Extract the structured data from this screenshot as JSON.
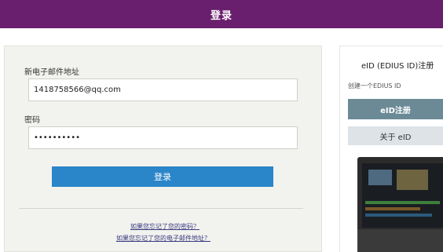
{
  "header": {
    "title": "登录"
  },
  "login_form": {
    "email_label": "新电子邮件地址",
    "email_value": "1418758566@qq.com",
    "password_label": "密码",
    "password_value": "••••••••••",
    "submit_label": "登录",
    "forgot_password_link": "如果您忘记了您的密码？",
    "forgot_email_link": "如果您忘记了您的电子邮件地址？"
  },
  "side": {
    "title": "eID (EDIUS ID)注册",
    "subtitle": "创建一个EDIUS ID",
    "register_button": "eID注册",
    "about_button": "关于 eID"
  },
  "colors": {
    "header_bg": "#6a1f6e",
    "login_button": "#2a85c9",
    "register_button": "#6b8a96"
  }
}
